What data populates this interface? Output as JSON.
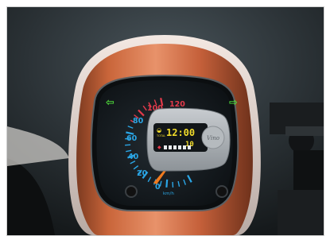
{
  "speedometer": {
    "ticks": [
      "0",
      "20",
      "40",
      "60",
      "80",
      "100",
      "120"
    ],
    "unit": "km/h",
    "odometer_label": "TOTAL",
    "clock": "12:00",
    "trip": "10",
    "brand_emblem": "Vino",
    "left_signal": "green",
    "right_signal": "green"
  },
  "colors": {
    "body_orange": "#c9653a",
    "gauge_blue": "#2aa6e6",
    "gauge_red": "#e23a4b",
    "lcd_yellow": "#f2dc2b",
    "signal_green": "#4fdc3b"
  }
}
